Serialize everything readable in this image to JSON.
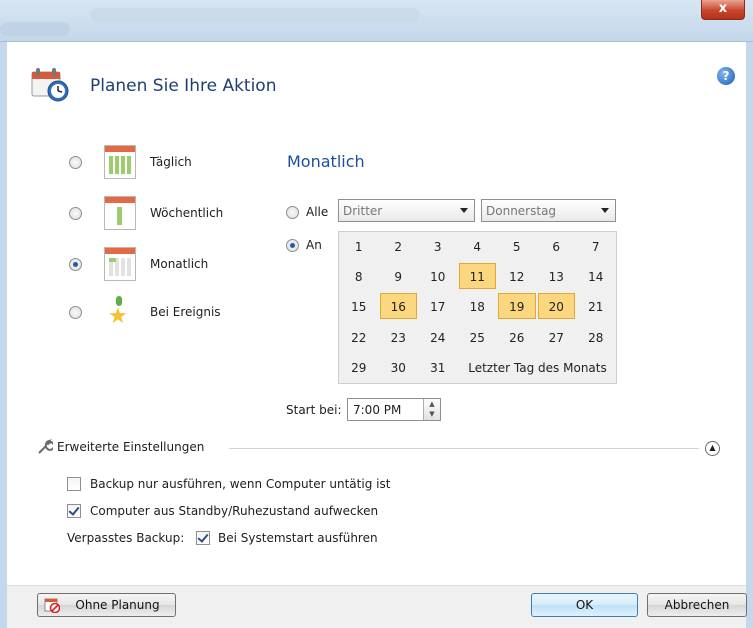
{
  "window": {
    "close_label": "x"
  },
  "header": {
    "title": "Planen Sie Ihre Aktion",
    "help_label": "?"
  },
  "frequency": {
    "options": [
      {
        "label": "Täglich",
        "checked": false
      },
      {
        "label": "Wöchentlich",
        "checked": false
      },
      {
        "label": "Monatlich",
        "checked": true
      },
      {
        "label": "Bei Ereignis",
        "checked": false
      }
    ]
  },
  "monthly": {
    "title": "Monatlich",
    "alle_label": "Alle",
    "alle_checked": false,
    "an_label": "An",
    "an_checked": true,
    "ordinal_select": "Dritter",
    "weekday_select": "Donnerstag",
    "days": [
      [
        "1",
        "2",
        "3",
        "4",
        "5",
        "6",
        "7"
      ],
      [
        "8",
        "9",
        "10",
        "11",
        "12",
        "13",
        "14"
      ],
      [
        "15",
        "16",
        "17",
        "18",
        "19",
        "20",
        "21"
      ],
      [
        "22",
        "23",
        "24",
        "25",
        "26",
        "27",
        "28"
      ],
      [
        "29",
        "30",
        "31"
      ]
    ],
    "selected_days": [
      "11",
      "16",
      "19",
      "20"
    ],
    "last_day_label": "Letzter Tag des Monats",
    "start_label": "Start bei:",
    "start_time": "7:00 PM"
  },
  "advanced": {
    "title": "Erweiterte Einstellungen",
    "idle_only_label": "Backup nur ausführen, wenn Computer untätig ist",
    "idle_only_checked": false,
    "wake_label": "Computer aus Standby/Ruhezustand aufwecken",
    "wake_checked": true,
    "missed_label": "Verpasstes Backup:",
    "missed_option_label": "Bei Systemstart ausführen",
    "missed_option_checked": true
  },
  "footer": {
    "no_schedule_label": "Ohne Planung",
    "ok_label": "OK",
    "cancel_label": "Abbrechen"
  },
  "colors": {
    "accent_blue": "#1e4e9a",
    "selected_day_fill": "#fbd77f",
    "selected_day_border": "#e0a735"
  }
}
